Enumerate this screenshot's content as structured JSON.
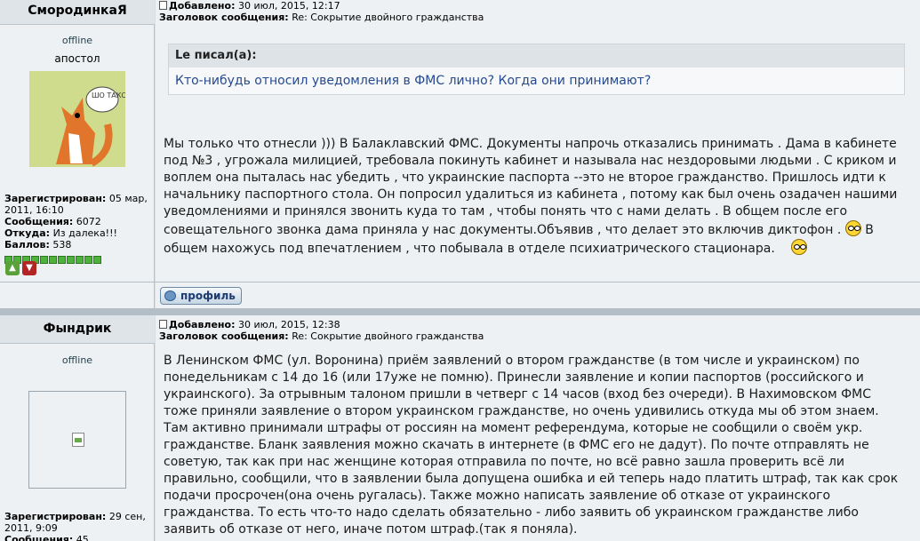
{
  "posts": [
    {
      "author": "СмородинкаЯ",
      "status": "offline",
      "rank": "апостол",
      "meta": {
        "added_label": "Добавлено:",
        "added_value": "30 июл, 2015, 12:17",
        "subject_label": "Заголовок сообщения:",
        "subject_value": "Re: Сокрытие двойного гражданства"
      },
      "info": {
        "registered_label": "Зарегистрирован:",
        "registered_value": "05 мар, 2011, 16:10",
        "messages_label": "Сообщения:",
        "messages_value": "6072",
        "from_label": "Откуда:",
        "from_value": "Из далека!!!",
        "points_label": "Баллов:",
        "points_value": "538"
      },
      "avatar_text": "ШО ТАКОЭ?",
      "quote": {
        "head": "Le писал(а):",
        "body": "Кто-нибудь относил уведомления в ФМС лично? Когда они принимают?"
      },
      "message_part1": "Мы только что отнесли ))) В Балаклавский ФМС. Документы напрочь отказались принимать . Дама в кабинете под №3 , угрожала милицией, требовала покинуть кабинет и называла нас нездоровыми людьми . С криком и воплем она пыталась нас убедить , что украинские паспорта --это не второе гражданство. Пришлось идти к начальнику паспортного стола. Он попросил удалиться из кабинета , потому как был очень озадачен нашими уведомлениями и принялся звонить куда то там , чтобы понять что с нами делать . В общем после его совещательного звонка дама приняла у нас документы.Объявив , что делает это включив диктофон .",
      "message_part2": " В общем нахожусь под впечатлением , что побывала в отделе психиатрического стационара.",
      "profile_label": "профиль"
    },
    {
      "author": "Фындрик",
      "status": "offline",
      "meta": {
        "added_label": "Добавлено:",
        "added_value": "30 июл, 2015, 12:38",
        "subject_label": "Заголовок сообщения:",
        "subject_value": "Re: Сокрытие двойного гражданства"
      },
      "info": {
        "registered_label": "Зарегистрирован:",
        "registered_value": "29 сен, 2011, 9:09",
        "messages_label": "Сообщения:",
        "messages_value": "45"
      },
      "message": "В Ленинском ФМС (ул. Воронина) приём заявлений о втором гражданстве (в том числе и украинском) по понедельникам с 14 до 16 (или 17уже не помню). Принесли заявление и копии паспортов (российского и украинского). За отрывным талоном пришли в четверг с 14 часов (вход без очереди). В Нахимовском ФМС тоже приняли заявление о втором украинском гражданстве, но очень удивились откуда мы об этом знаем. Там активно принимали штрафы от россиян на момент референдума, которые не сообщили о своём укр. гражданстве. Бланк заявления можно скачать в интернете (в ФМС его не дадут). По почте отправлять не советую, так как при нас женщине которая отправила по почте, но всё равно зашла проверить всё ли правильно, сообщили, что в заявлении была допущена ошибка и ей теперь надо платить штраф, так как срок подачи просрочен(она очень ругалась). Также можно написать заявление об отказе от украинского гражданства. То есть что-то надо сделать обязательно - либо заявить об украинском гражданстве либо заявить об отказе от него, иначе потом штраф.(так я поняла)."
    }
  ]
}
